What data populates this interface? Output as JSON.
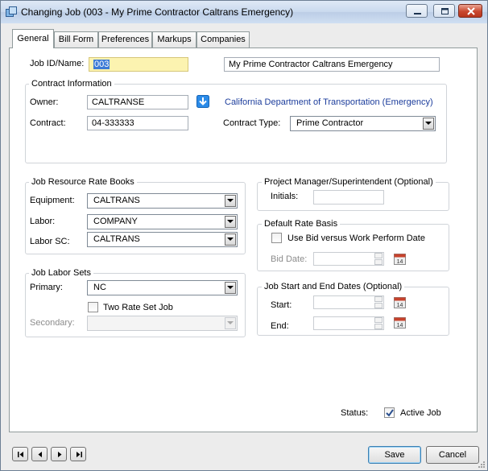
{
  "window": {
    "title": "Changing Job  (003 - My Prime Contractor Caltrans Emergency)"
  },
  "tabs": [
    {
      "label": "General"
    },
    {
      "label": "Bill Form"
    },
    {
      "label": "Preferences"
    },
    {
      "label": "Markups"
    },
    {
      "label": "Companies"
    }
  ],
  "job": {
    "id_label": "Job ID/Name:",
    "id_value": "003",
    "name_value": "My Prime Contractor Caltrans Emergency"
  },
  "contract": {
    "group_title": "Contract Information",
    "owner_label": "Owner:",
    "owner_value": "CALTRANSE",
    "owner_link": "California Department of Transportation (Emergency)",
    "contract_label": "Contract:",
    "contract_value": "04-333333",
    "type_label": "Contract Type:",
    "type_value": "Prime Contractor"
  },
  "rate_books": {
    "group_title": "Job Resource Rate Books",
    "equipment_label": "Equipment:",
    "equipment_value": "CALTRANS",
    "labor_label": "Labor:",
    "labor_value": "COMPANY",
    "labor_sc_label": "Labor SC:",
    "labor_sc_value": "CALTRANS"
  },
  "labor_sets": {
    "group_title": "Job Labor Sets",
    "primary_label": "Primary:",
    "primary_value": "NC",
    "two_rate_label": "Two Rate Set Job",
    "two_rate_checked": false,
    "secondary_label": "Secondary:",
    "secondary_value": ""
  },
  "project_manager": {
    "group_title": "Project Manager/Superintendent (Optional)",
    "initials_label": "Initials:",
    "initials_value": ""
  },
  "rate_basis": {
    "group_title": "Default Rate Basis",
    "use_bid_label": "Use Bid versus Work Perform Date",
    "use_bid_checked": false,
    "bid_date_label": "Bid Date:",
    "bid_date_value": ""
  },
  "dates": {
    "group_title": "Job Start and End Dates (Optional)",
    "start_label": "Start:",
    "start_value": "",
    "end_label": "End:",
    "end_value": "",
    "calendar_day": "14"
  },
  "status": {
    "label": "Status:",
    "active_label": "Active Job",
    "active_checked": true
  },
  "buttons": {
    "save": "Save",
    "cancel": "Cancel"
  },
  "colors": {
    "link": "#1c3d9c",
    "selection": "#3d7bd6",
    "highlight_field": "#fcf3b0",
    "owner_arrow": "#2b8be8"
  }
}
